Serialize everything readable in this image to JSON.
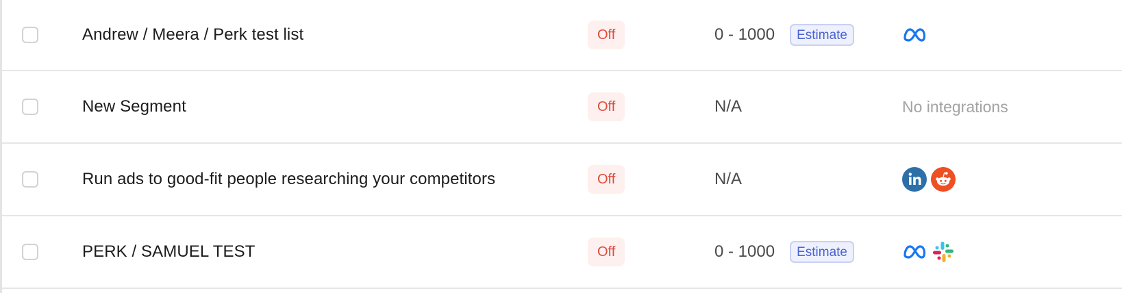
{
  "rows": [
    {
      "name": "Andrew / Meera / Perk test list",
      "status": "Off",
      "size": "0 - 1000",
      "estimate_label": "Estimate",
      "integrations": [
        "meta-icon"
      ],
      "no_integrations_text": ""
    },
    {
      "name": "New Segment",
      "status": "Off",
      "size": "N/A",
      "estimate_label": "",
      "integrations": [],
      "no_integrations_text": "No integrations"
    },
    {
      "name": "Run ads to good-fit people researching your competitors",
      "status": "Off",
      "size": "N/A",
      "estimate_label": "",
      "integrations": [
        "linkedin-icon",
        "reddit-icon"
      ],
      "no_integrations_text": ""
    },
    {
      "name": "PERK / SAMUEL TEST",
      "status": "Off",
      "size": "0 - 1000",
      "estimate_label": "Estimate",
      "integrations": [
        "meta-icon",
        "slack-icon"
      ],
      "no_integrations_text": ""
    }
  ],
  "colors": {
    "status_off_text": "#df4a3c",
    "status_off_bg": "#fdf0ef",
    "estimate_text": "#4a62d2",
    "estimate_bg": "#eef1fd",
    "meta_blue": "#1877f2",
    "linkedin_blue": "#2d6fa8",
    "reddit_orange": "#ee4f23"
  }
}
